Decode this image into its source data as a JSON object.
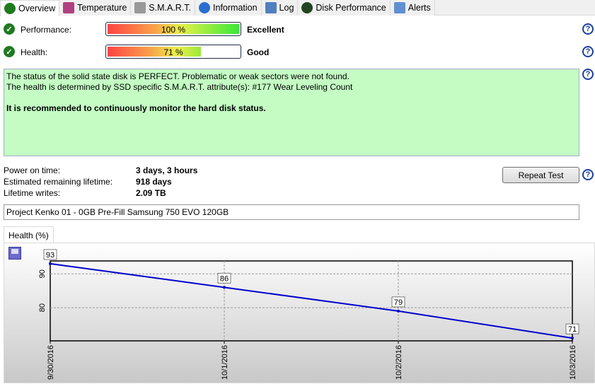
{
  "tabs": [
    {
      "label": "Overview",
      "icon": "check-icon"
    },
    {
      "label": "Temperature",
      "icon": "thermometer-icon"
    },
    {
      "label": "S.M.A.R.T.",
      "icon": "smart-icon"
    },
    {
      "label": "Information",
      "icon": "info-icon"
    },
    {
      "label": "Log",
      "icon": "log-icon"
    },
    {
      "label": "Disk Performance",
      "icon": "gauge-icon"
    },
    {
      "label": "Alerts",
      "icon": "alerts-icon"
    }
  ],
  "performance": {
    "label": "Performance:",
    "percent": 100,
    "text": "100 %",
    "status": "Excellent"
  },
  "health": {
    "label": "Health:",
    "percent": 71,
    "text": "71 %",
    "status": "Good"
  },
  "message": {
    "line1": "The status of the solid state disk is PERFECT. Problematic or weak sectors were not found.",
    "line2": "The health is determined by SSD specific S.M.A.R.T. attribute(s):  #177 Wear Leveling Count",
    "line3": "It is recommended to continuously monitor the hard disk status."
  },
  "stats": [
    {
      "label": "Power on time:",
      "value": "3 days, 3 hours"
    },
    {
      "label": "Estimated remaining lifetime:",
      "value": "918 days"
    },
    {
      "label": "Lifetime writes:",
      "value": "2.09 TB"
    }
  ],
  "repeat_test": "Repeat Test",
  "disk_name": "Project Kenko 01 - 0GB Pre-Fill Samsung 750 EVO 120GB",
  "help": "?",
  "chart_tab": "Health (%)",
  "chart_data": {
    "type": "line",
    "title": "Health (%)",
    "x": [
      "9/30/2016",
      "10/1/2016",
      "10/2/2016",
      "10/3/2016"
    ],
    "values": [
      93,
      86,
      79,
      71
    ],
    "yticks": [
      80,
      90
    ],
    "ylim": [
      70.2,
      93.8
    ],
    "grid": true,
    "color": "#0000cc"
  }
}
